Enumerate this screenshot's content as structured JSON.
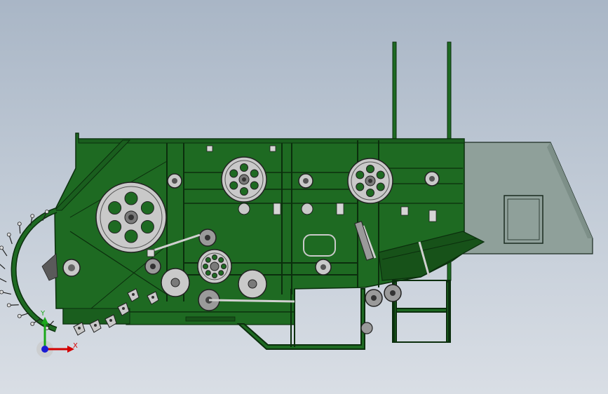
{
  "colors": {
    "background_top": "#a9b6c6",
    "background_bottom": "#d9dee5",
    "frame_green": "#1e6a22",
    "frame_dark": "#0b2e0d",
    "wheel_gray": "#c9c9c9",
    "wheel_dark": "#5a5a5a",
    "hopper_gray": "#8fa09a",
    "axis_x": "#d40000",
    "axis_y": "#1aa81a",
    "axis_z": "#1a1ad4"
  },
  "triad": {
    "x_label": "X",
    "y_label": "Y"
  }
}
